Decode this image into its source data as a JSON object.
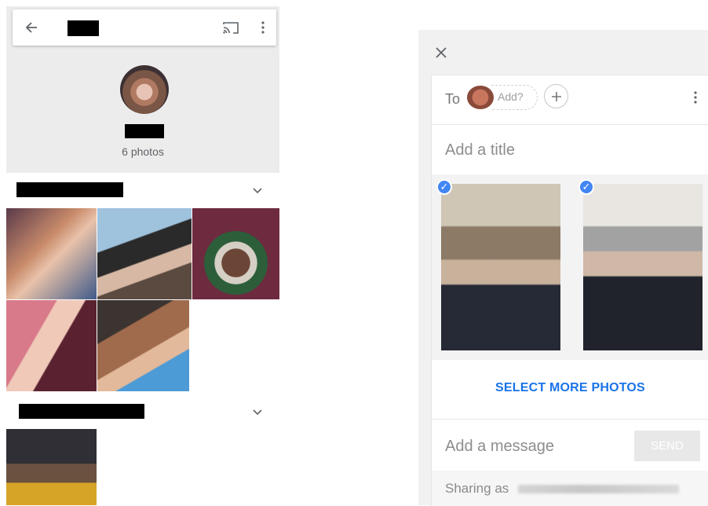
{
  "album": {
    "photo_count_label": "6 photos"
  },
  "share": {
    "to_label": "To",
    "add_chip_label": "Add?",
    "title_placeholder": "Add a title",
    "select_more_label": "SELECT MORE PHOTOS",
    "message_placeholder": "Add a message",
    "send_label": "SEND",
    "sharing_as_label": "Sharing as"
  },
  "colors": {
    "accent": "#4285f4",
    "link": "#1a73e8",
    "send_disabled_bg": "#e8e8e8",
    "panel_bg": "#f1f1f1"
  }
}
